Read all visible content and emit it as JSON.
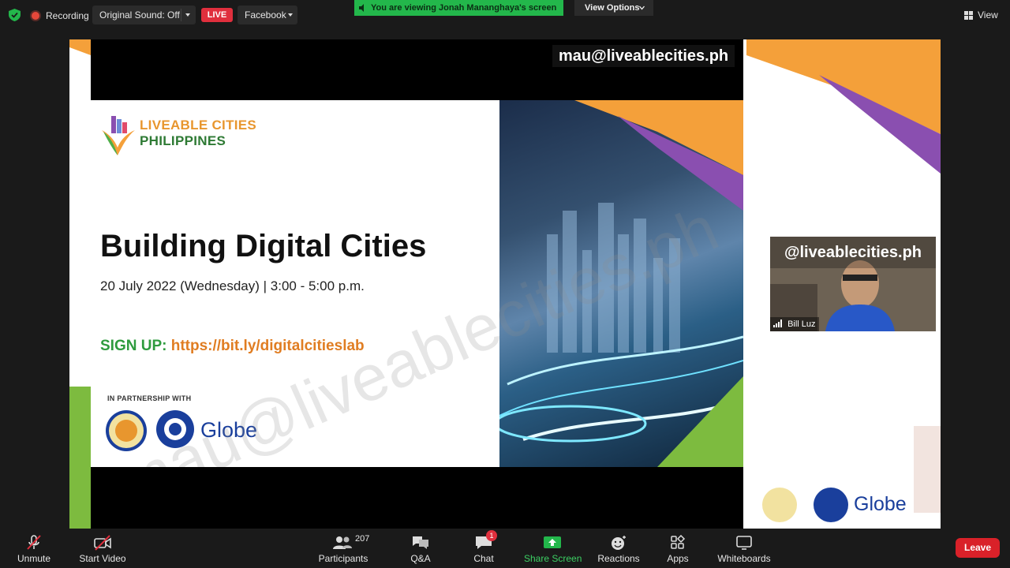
{
  "top_bar": {
    "recording_label": "Recording",
    "sound_label": "Original Sound: Off",
    "live_label": "LIVE",
    "stream_target": "Facebook",
    "viewing_banner": "You are viewing Jonah Mananghaya's screen",
    "view_options_label": "View Options",
    "view_label": "View"
  },
  "shared_screen": {
    "email_overlay": "mau@liveablecities.ph",
    "logo_line1": "LIVEABLE CITIES",
    "logo_line2": "PHILIPPINES",
    "title": "Building Digital Cities",
    "date_line": "20 July 2022 (Wednesday) | 3:00 - 5:00 p.m.",
    "signup_key": "SIGN UP:",
    "signup_url": "https://bit.ly/digitalcitieslab",
    "partnership_label": "IN PARTNERSHIP WITH",
    "partner_brand": "Globe",
    "watermark": "mau@liveablecities.ph"
  },
  "video_tile": {
    "handle_overlay": "@liveablecities.ph",
    "participant_name": "Bill Luz"
  },
  "toolbar": {
    "unmute": "Unmute",
    "start_video": "Start Video",
    "participants_count": "207",
    "participants": "Participants",
    "qa": "Q&A",
    "chat": "Chat",
    "chat_badge": "1",
    "share_screen": "Share Screen",
    "reactions": "Reactions",
    "apps": "Apps",
    "whiteboards": "Whiteboards",
    "leave": "Leave"
  },
  "colors": {
    "accent_green": "#23b74b",
    "live_red": "#e02f3d",
    "leave_red": "#d92129",
    "brand_orange": "#f4a03a",
    "brand_purple": "#8a4fb0"
  }
}
